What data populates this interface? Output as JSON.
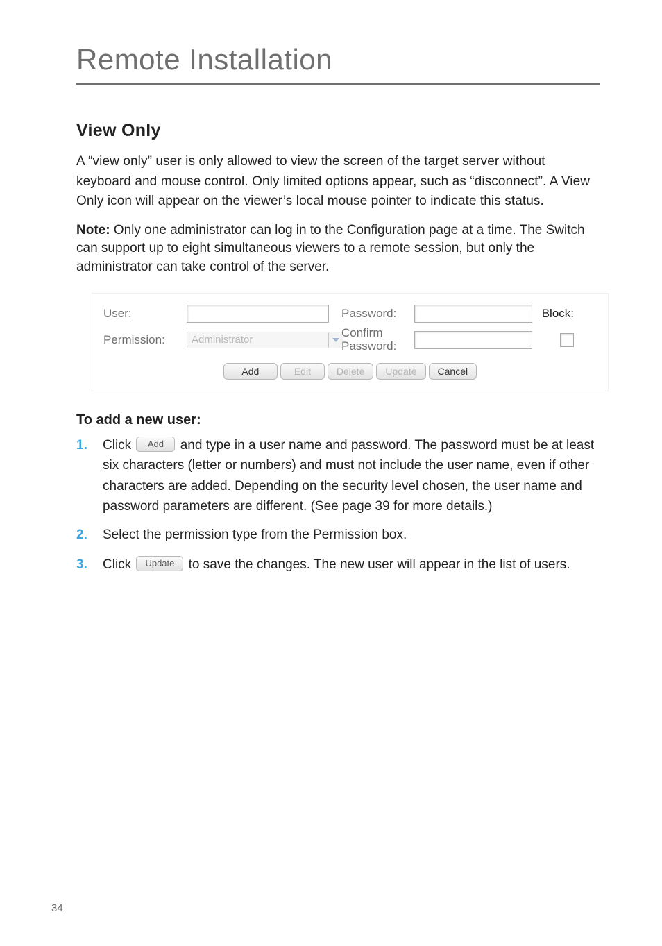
{
  "page": {
    "chapter_title": "Remote Installation",
    "section_heading": "View Only",
    "para1": "A “view only” user is only allowed to view the screen of the target server without keyboard and mouse control. Only limited options appear, such as “disconnect”. A View Only icon will appear on the viewer’s local mouse pointer to indicate this status.",
    "note_label": "Note:",
    "note_body": " Only one administrator can log in to the Configuration page at a time. The Switch can support up to eight simultaneous viewers to a remote session, but only the administrator can take control of the server.",
    "sub_heading": "To add a new user:",
    "page_number": "34"
  },
  "panel": {
    "labels": {
      "user": "User:",
      "permission": "Permission:",
      "password": "Password:",
      "confirm": "Confirm Password:",
      "block": "Block:"
    },
    "permission_value": "Administrator",
    "buttons": {
      "add": "Add",
      "edit": "Edit",
      "delete": "Delete",
      "update": "Update",
      "cancel": "Cancel"
    }
  },
  "list": {
    "item1": {
      "num": "1.",
      "pre": "Click",
      "btn": "Add",
      "post": " and type in a user name and password. The password must be at least six characters (letter or numbers) and must not include the user name, even if other characters are added. Depending on the security level chosen, the user name and password parameters are different. (See page 39 for more details.)"
    },
    "item2": {
      "num": "2.",
      "text": "Select the permission type from the Permission box."
    },
    "item3": {
      "num": "3.",
      "pre": "Click",
      "btn": "Update",
      "post": " to save the changes. The new user will appear in the list of users."
    }
  }
}
